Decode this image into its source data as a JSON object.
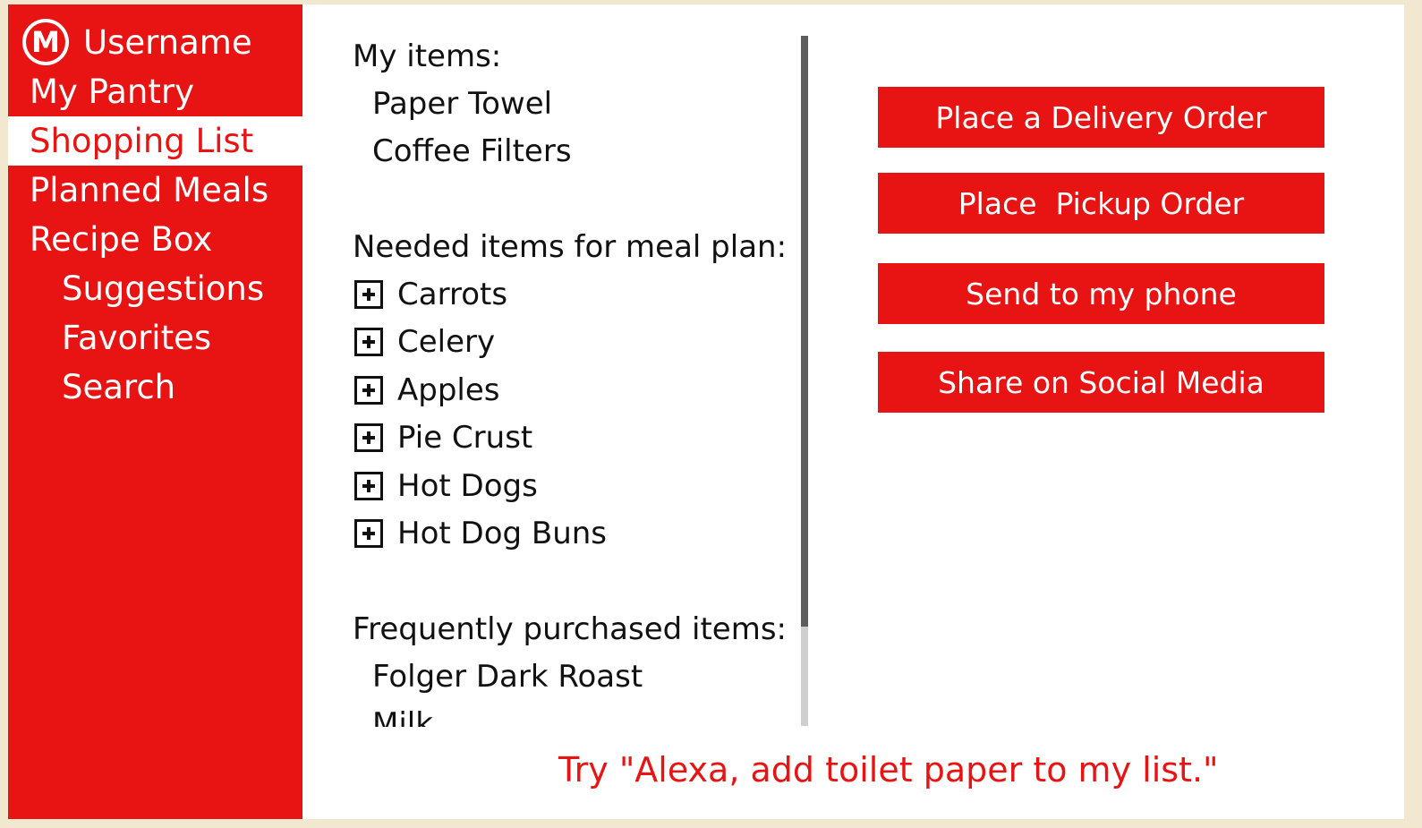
{
  "sidebar": {
    "logo_letter": "M",
    "username": "Username",
    "nav": [
      {
        "label": "My Pantry"
      },
      {
        "label": "Shopping List"
      },
      {
        "label": "Planned Meals"
      },
      {
        "label": "Recipe Box"
      },
      {
        "label": "Suggestions"
      },
      {
        "label": "Favorites"
      },
      {
        "label": "Search"
      }
    ],
    "active_item": "Shopping List"
  },
  "shopping": {
    "my_items_title": "My items:",
    "my_items": [
      "Paper Towel",
      "Coffee Filters"
    ],
    "meal_plan_title": "Needed items for meal plan:",
    "meal_plan_items": [
      "Carrots",
      "Celery",
      "Apples",
      "Pie Crust",
      "Hot Dogs",
      "Hot Dog Buns"
    ],
    "frequent_title": "Frequently purchased items:",
    "frequent_items": [
      "Folger Dark Roast",
      "Milk"
    ],
    "item_icon": "plus-box-icon"
  },
  "actions": {
    "delivery": "Place a Delivery Order",
    "pickup": "Place  Pickup Order",
    "phone": "Send to my phone",
    "social": "Share on Social Media"
  },
  "hint": "Try \"Alexa, add toilet paper to my list.\"",
  "colors": {
    "accent": "#e81313",
    "background": "#ffffff",
    "frame": "#f1e8cf"
  }
}
